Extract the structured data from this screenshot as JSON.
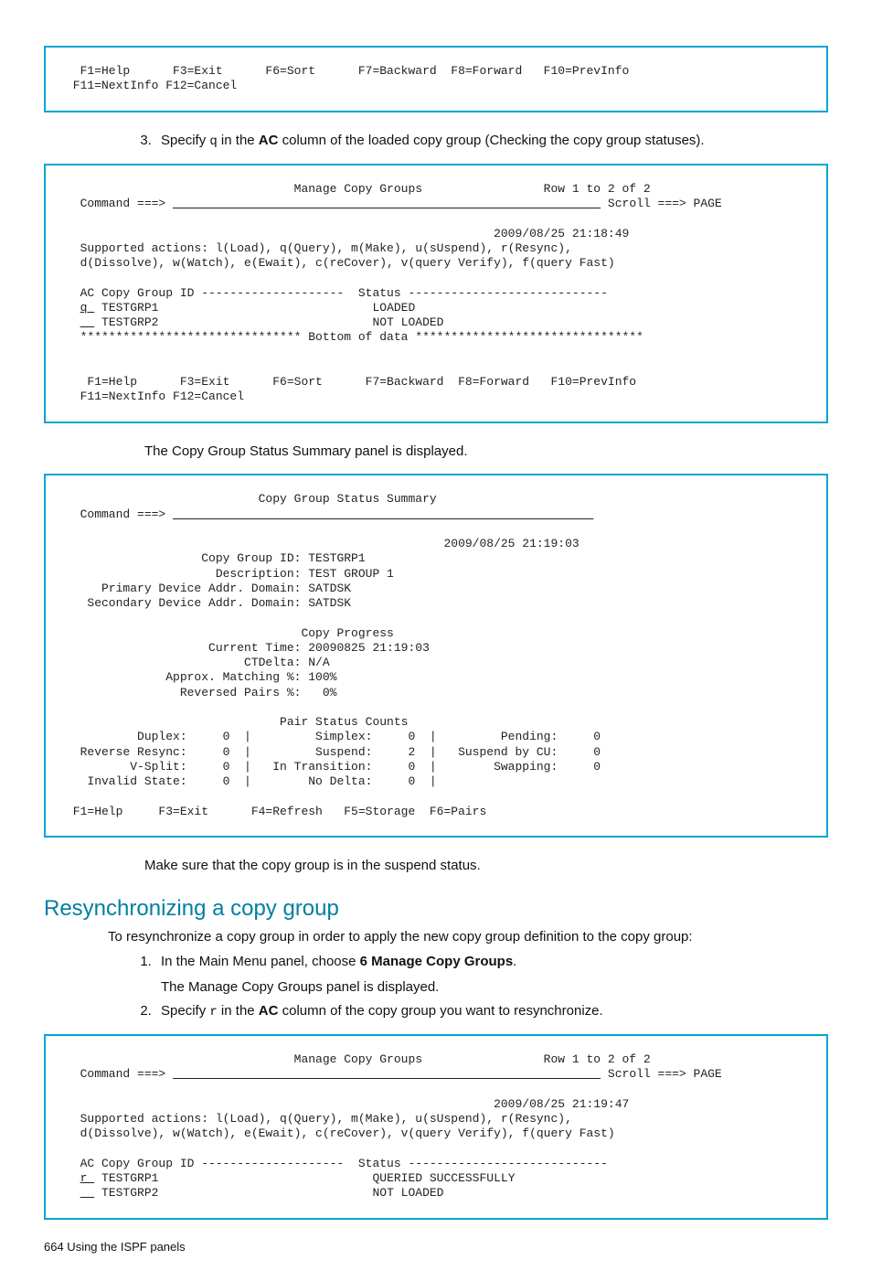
{
  "panel1": {
    "fkeys_l1": "  F1=Help      F3=Exit      F6=Sort      F7=Backward  F8=Forward   F10=PrevInfo",
    "fkeys_l2": " F11=NextInfo F12=Cancel"
  },
  "step3": {
    "prefix": "Specify ",
    "code": "q",
    "mid": " in the ",
    "bold": "AC",
    "suffix": " column of the loaded copy group (Checking the copy group statuses)."
  },
  "panel2": {
    "l01": "                                Manage Copy Groups                 Row 1 to 2 of 2",
    "l02a": "  Command ===> ",
    "l02b": "                                                            ",
    "l02c": " Scroll ===> PAGE",
    "l03": "",
    "l04": "                                                            2009/08/25 21:18:49",
    "l05": "  Supported actions: l(Load), q(Query), m(Make), u(sUspend), r(Resync),",
    "l06": "  d(Dissolve), w(Watch), e(Ewait), c(reCover), v(query Verify), f(query Fast)",
    "l07": "",
    "l08": "  AC Copy Group ID --------------------  Status ----------------------------",
    "l09a": "  ",
    "l09b": "q ",
    "l09c": " TESTGRP1                              LOADED",
    "l10a": "  ",
    "l10b": "  ",
    "l10c": " TESTGRP2                              NOT LOADED",
    "l11": "  ******************************* Bottom of data ********************************",
    "l12": "",
    "l13": "",
    "l14": "   F1=Help      F3=Exit      F6=Sort      F7=Backward  F8=Forward   F10=PrevInfo",
    "l15": "  F11=NextInfo F12=Cancel"
  },
  "text_after_panel2": "The Copy Group Status Summary panel is displayed.",
  "panel3": {
    "l01": "                           Copy Group Status Summary",
    "l02a": "  Command ===> ",
    "l02b": "                                                           ",
    "l03": "",
    "l04": "                                                     2009/08/25 21:19:03",
    "l05": "                   Copy Group ID: TESTGRP1",
    "l06": "                     Description: TEST GROUP 1",
    "l07": "     Primary Device Addr. Domain: SATDSK",
    "l08": "   Secondary Device Addr. Domain: SATDSK",
    "l09": "",
    "l10": "                                 Copy Progress",
    "l11": "                    Current Time: 20090825 21:19:03",
    "l12": "                         CTDelta: N/A",
    "l13": "              Approx. Matching %: 100%",
    "l14": "                Reversed Pairs %:   0%",
    "l15": "",
    "l16": "                              Pair Status Counts",
    "l17": "          Duplex:     0  |         Simplex:     0  |         Pending:     0",
    "l18": "  Reverse Resync:     0  |         Suspend:     2  |   Suspend by CU:     0",
    "l19": "         V-Split:     0  |   In Transition:     0  |        Swapping:     0",
    "l20": "   Invalid State:     0  |        No Delta:     0  |",
    "l21": "",
    "l22": " F1=Help     F3=Exit      F4=Refresh   F5=Storage  F6=Pairs"
  },
  "text_after_panel3": "Make sure that the copy group is in the suspend status.",
  "section_title": "Resynchronizing a copy group",
  "intro_text": "To resynchronize a copy group in order to apply the new copy group definition to the copy group:",
  "step1": {
    "prefix": "In the Main Menu panel, choose ",
    "bold": "6 Manage Copy Groups",
    "suffix": ".",
    "sub": "The Manage Copy Groups panel is displayed."
  },
  "step2": {
    "prefix": "Specify ",
    "code": "r",
    "mid": " in the ",
    "bold": "AC",
    "suffix": " column of the copy group you want to resynchronize."
  },
  "panel4": {
    "l01": "                                Manage Copy Groups                 Row 1 to 2 of 2",
    "l02a": "  Command ===> ",
    "l02b": "                                                            ",
    "l02c": " Scroll ===> PAGE",
    "l03": "",
    "l04": "                                                            2009/08/25 21:19:47",
    "l05": "  Supported actions: l(Load), q(Query), m(Make), u(sUspend), r(Resync),",
    "l06": "  d(Dissolve), w(Watch), e(Ewait), c(reCover), v(query Verify), f(query Fast)",
    "l07": "",
    "l08": "  AC Copy Group ID --------------------  Status ----------------------------",
    "l09a": "  ",
    "l09b": "r ",
    "l09c": " TESTGRP1                              QUERIED SUCCESSFULLY",
    "l10a": "  ",
    "l10b": "  ",
    "l10c": " TESTGRP2                              NOT LOADED"
  },
  "footer": "664   Using the ISPF panels"
}
